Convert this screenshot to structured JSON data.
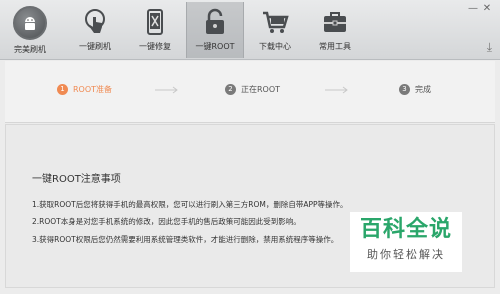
{
  "toolbar": {
    "logo_label": "完美刷机",
    "tools": [
      {
        "label": "一键刷机",
        "icon": "hand-touch-icon"
      },
      {
        "label": "一键修复",
        "icon": "phone-tools-icon"
      },
      {
        "label": "一键ROOT",
        "icon": "unlock-icon"
      },
      {
        "label": "下载中心",
        "icon": "cart-icon"
      },
      {
        "label": "常用工具",
        "icon": "toolbox-icon"
      }
    ],
    "download_icon": "download-icon"
  },
  "steps": [
    {
      "number": "1",
      "label": "ROOT准备"
    },
    {
      "number": "2",
      "label": "正在ROOT"
    },
    {
      "number": "3",
      "label": "完成"
    }
  ],
  "notice": {
    "title": "一键ROOT注意事项",
    "items": [
      "1.获取ROOT后您将获得手机的最高权限，您可以进行刷入第三方ROM，删除自带APP等操作。",
      "2.ROOT本身是对您手机系统的修改，因此您手机的售后政策可能因此受到影响。",
      "3.获得ROOT权限后您仍然需要利用系统管理类软件，才能进行删除，禁用系统程序等操作。"
    ]
  },
  "watermark": {
    "main": "百科全说",
    "sub": "助你轻松解决"
  },
  "colors": {
    "accent": "#f08a52",
    "watermark_green": "#2aa66a"
  }
}
